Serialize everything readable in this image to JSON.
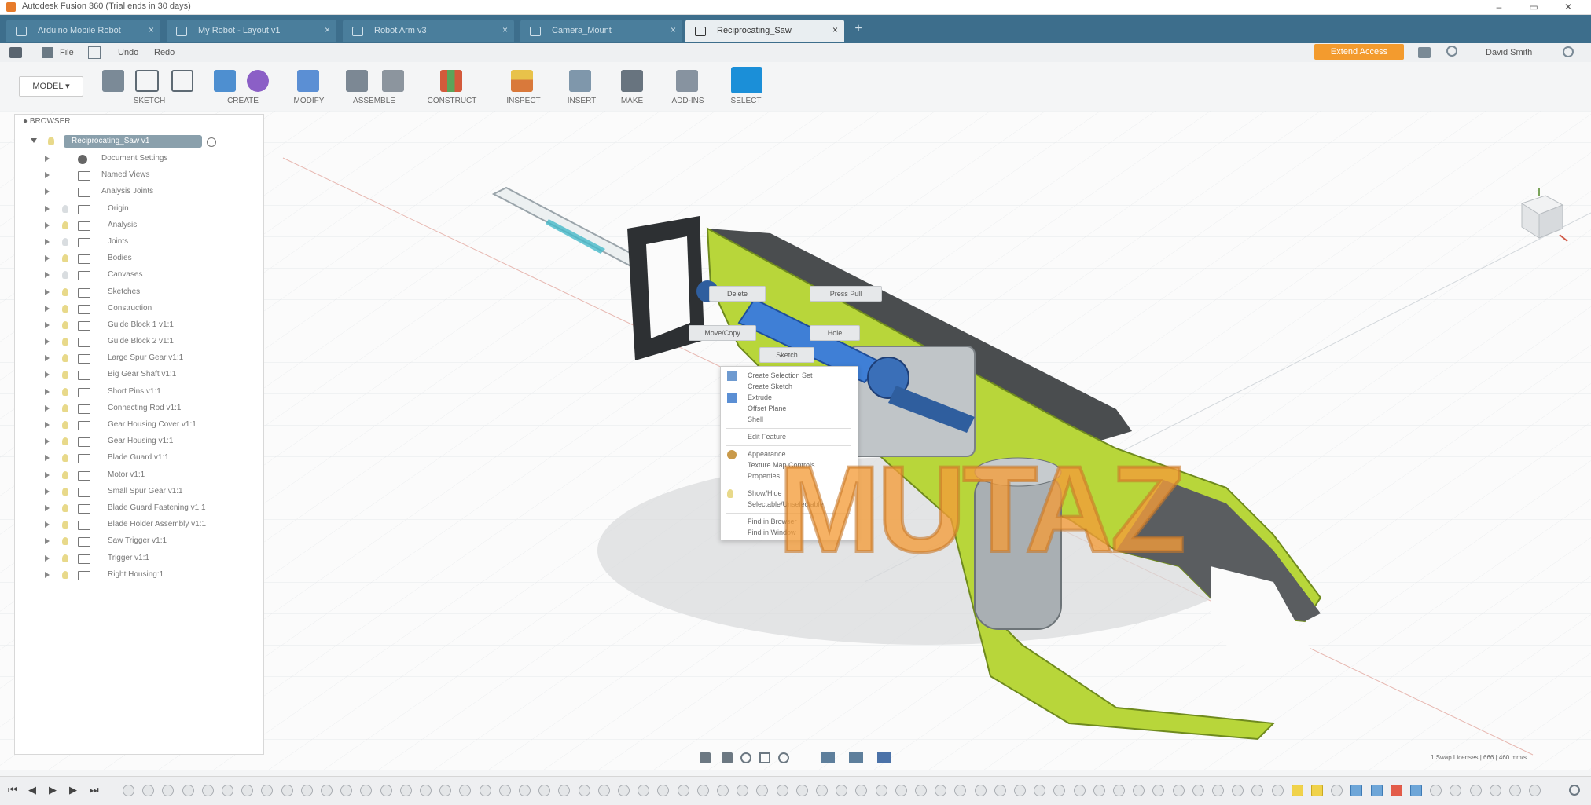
{
  "app": {
    "title": "Autodesk Fusion 360 (Trial ends in 30 days)"
  },
  "tabs": [
    {
      "label": "Arduino Mobile Robot",
      "active": false
    },
    {
      "label": "My Robot - Layout v1",
      "active": false
    },
    {
      "label": "Robot Arm v3",
      "active": false
    },
    {
      "label": "Camera_Mount",
      "active": false
    },
    {
      "label": "Reciprocating_Saw",
      "active": true
    }
  ],
  "quick_access": {
    "file": "File",
    "undo": "Undo",
    "redo": "Redo",
    "extension_button": "Extend Access",
    "user": "David Smith"
  },
  "ribbon": {
    "workspace": "MODEL",
    "groups": [
      "SKETCH",
      "CREATE",
      "MODIFY",
      "ASSEMBLE",
      "CONSTRUCT",
      "INSPECT",
      "INSERT",
      "MAKE",
      "ADD-INS",
      "SELECT"
    ]
  },
  "browser": {
    "header": "BROWSER",
    "root": "Reciprocating_Saw v1",
    "items": [
      "Document Settings",
      "Named Views",
      "Analysis Joints",
      "Origin",
      "Analysis",
      "Joints",
      "Bodies",
      "Canvases",
      "Sketches",
      "Construction",
      "Guide Block 1 v1:1",
      "Guide Block 2 v1:1",
      "Large Spur Gear v1:1",
      "Big Gear Shaft v1:1",
      "Short Pins v1:1",
      "Connecting Rod v1:1",
      "Gear Housing Cover v1:1",
      "Gear Housing v1:1",
      "Blade Guard v1:1",
      "Motor v1:1",
      "Small Spur Gear v1:1",
      "Blade Guard Fastening v1:1",
      "Blade Holder Assembly v1:1",
      "Saw Trigger v1:1",
      "Trigger v1:1",
      "Right Housing:1"
    ]
  },
  "marking_menu": {
    "delete": "Delete",
    "press_pull": "Press Pull",
    "move_copy": "Move/Copy",
    "hole": "Hole",
    "sketch": "Sketch"
  },
  "context_menu": {
    "items": [
      "Create Selection Set",
      "Create Sketch",
      "Extrude",
      "Offset Plane",
      "Shell",
      "Edit Feature",
      "Appearance",
      "Texture Map Controls",
      "Properties",
      "Show/Hide",
      "Selectable/Unselectable",
      "Find in Browser",
      "Find in Window"
    ]
  },
  "status": {
    "right_text": "1 Swap Licenses | 666 | 460 mm/s"
  },
  "watermark": "MUTAZ",
  "colors": {
    "tab_bar": "#3d6e8c",
    "accent_orange": "#f39b2e",
    "model_yellow_green": "#b8d63a",
    "model_blue": "#3f7fd6",
    "watermark": "#f39c3a"
  }
}
